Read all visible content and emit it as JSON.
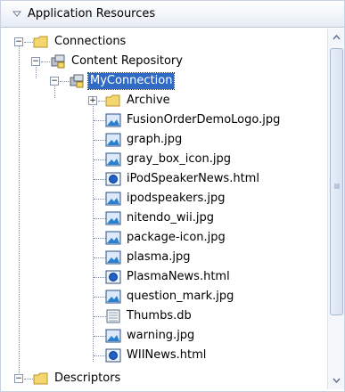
{
  "panel": {
    "title": "Application Resources"
  },
  "tree": {
    "connections": "Connections",
    "content_repository": "Content Repository",
    "my_connection": "MyConnection",
    "archive": "Archive",
    "files": [
      "FusionOrderDemoLogo.jpg",
      "graph.jpg",
      "gray_box_icon.jpg",
      "iPodSpeakerNews.html",
      "ipodspeakers.jpg",
      "nitendo_wii.jpg",
      "package-icon.jpg",
      "plasma.jpg",
      "PlasmaNews.html",
      "question_mark.jpg",
      "Thumbs.db",
      "warning.jpg",
      "WIINews.html"
    ],
    "descriptors": "Descriptors"
  },
  "colors": {
    "selection": "#316ac5",
    "folder": "#f3d66e"
  },
  "icons": {
    "image": "image-file-icon",
    "html": "html-file-icon",
    "db": "db-file-icon",
    "folder": "folder-icon",
    "repository": "repository-icon"
  }
}
